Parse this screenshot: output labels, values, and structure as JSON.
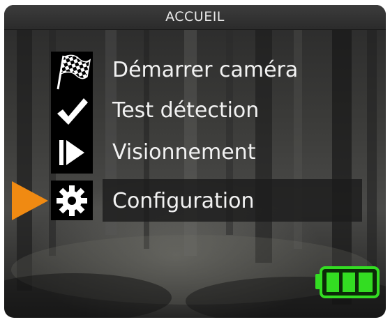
{
  "header": {
    "title": "ACCUEIL"
  },
  "menu": {
    "items": [
      {
        "label": "Démarrer caméra",
        "icon": "checkered-flag-icon"
      },
      {
        "label": "Test détection",
        "icon": "checkmark-icon"
      },
      {
        "label": "Visionnement",
        "icon": "play-icon"
      },
      {
        "label": "Configuration",
        "icon": "gear-icon"
      }
    ],
    "selected_index": 3,
    "selector_color": "#f08a12"
  },
  "status": {
    "battery_level": 1.0,
    "battery_color": "#33dd22"
  }
}
